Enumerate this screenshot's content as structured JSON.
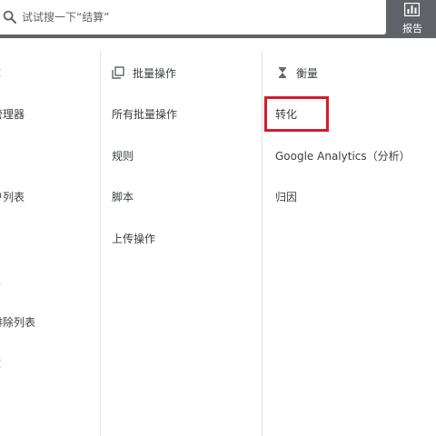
{
  "search": {
    "placeholder": "试试搜一下“结算”"
  },
  "reports_button": {
    "label": "报告"
  },
  "left_column": {
    "partial_labels": [
      "库",
      "管理器",
      "户列表",
      "且",
      "排除列表",
      "库"
    ]
  },
  "bulk_column": {
    "header": "批量操作",
    "items": [
      "所有批量操作",
      "规则",
      "脚本",
      "上传操作"
    ]
  },
  "measure_column": {
    "header": "衡量",
    "items": [
      "转化",
      "Google Analytics（分析）",
      "归因"
    ]
  },
  "colors": {
    "topbar": "#5f6368",
    "highlight": "#d21c2b"
  },
  "icons": [
    "search-icon",
    "bar-chart-icon",
    "copy-icon",
    "hourglass-icon"
  ]
}
